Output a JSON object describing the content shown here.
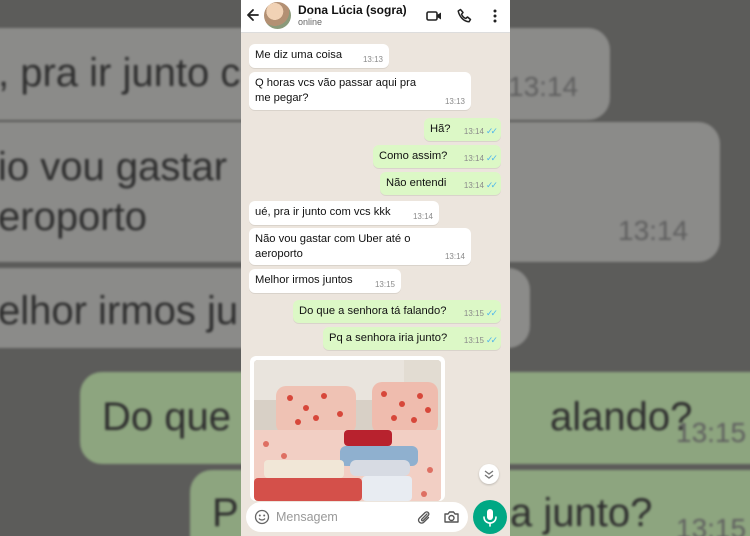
{
  "background": {
    "blur_lines": [
      ", pra ir junto c",
      "io vou gastar",
      "eroporto",
      "elhor irmos ju",
      "Do que",
      "P",
      "alando?",
      "a junto?"
    ],
    "blur_times": [
      "13:14",
      "13:14",
      "13:15",
      "13:15"
    ]
  },
  "header": {
    "contact_name": "Dona Lúcia (sogra)",
    "status": "online"
  },
  "messages": [
    {
      "text": "Me diz uma coisa",
      "time": "13:13"
    },
    {
      "text": "Q horas vcs vão passar aqui pra me pegar?",
      "time": "13:13"
    },
    {
      "text": "Hã?",
      "time": "13:14"
    },
    {
      "text": "Como assim?",
      "time": "13:14"
    },
    {
      "text": "Não entendi",
      "time": "13:14"
    },
    {
      "text": "ué, pra ir junto com vcs kkk",
      "time": "13:14"
    },
    {
      "text": "Não vou gastar com Uber até o aeroporto",
      "time": "13:14"
    },
    {
      "text": "Melhor irmos juntos",
      "time": "13:15"
    },
    {
      "text": "Do que a senhora tá falando?",
      "time": "13:15"
    },
    {
      "text": "Pq a senhora iria junto?",
      "time": "13:15"
    }
  ],
  "input": {
    "placeholder": "Mensagem"
  },
  "colors": {
    "accent": "#00a884",
    "outgoing_bubble": "#dcf8c6",
    "incoming_bubble": "#ffffff",
    "chat_bg": "#ece5dd",
    "read_ticks": "#4fb6ec"
  },
  "icons": [
    "back-arrow-icon",
    "video-call-icon",
    "phone-icon",
    "more-vert-icon",
    "emoji-icon",
    "attach-icon",
    "camera-icon",
    "mic-icon",
    "chevron-down-icon",
    "read-ticks-icon"
  ]
}
